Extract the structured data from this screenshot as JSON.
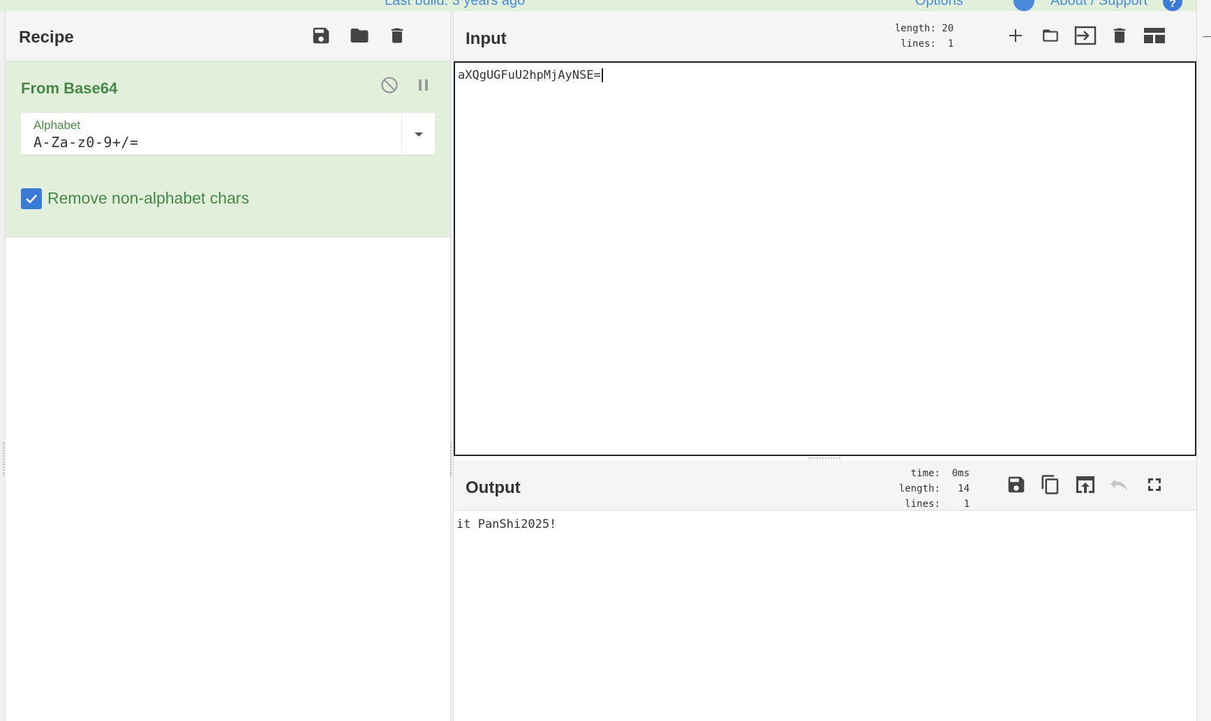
{
  "banner": {
    "build_text": "Last build: 3 years ago",
    "options_label": "Options",
    "about_label": "About / Support",
    "help_glyph": "?"
  },
  "recipe": {
    "title": "Recipe",
    "icons": [
      "save-icon",
      "folder-icon",
      "trash-icon"
    ],
    "operation": {
      "name": "From Base64",
      "alphabet_label": "Alphabet",
      "alphabet_value": "A-Za-z0-9+/=",
      "remove_nonalphabet_label": "Remove non-alphabet chars",
      "remove_nonalphabet_checked": true
    }
  },
  "input": {
    "title": "Input",
    "stats": "length: 20\n lines:  1",
    "text": "aXQgUGFuU2hpMjAyNSE=",
    "icons": [
      "plus-icon",
      "folder-icon",
      "sign-in-icon",
      "trash-icon",
      "layout-icon"
    ]
  },
  "output": {
    "title": "Output",
    "stats": "  time:  0ms\nlength:   14\n lines:    1",
    "text": "it PanShi2025!",
    "icons": [
      "save-icon",
      "copy-icon",
      "replace-input-icon",
      "undo-icon",
      "fullscreen-icon"
    ]
  },
  "colors": {
    "operation_bg": "#e2efda",
    "operation_text": "#468847",
    "accent_blue": "#3a7bd5",
    "header_bg": "#f5f5f5"
  }
}
